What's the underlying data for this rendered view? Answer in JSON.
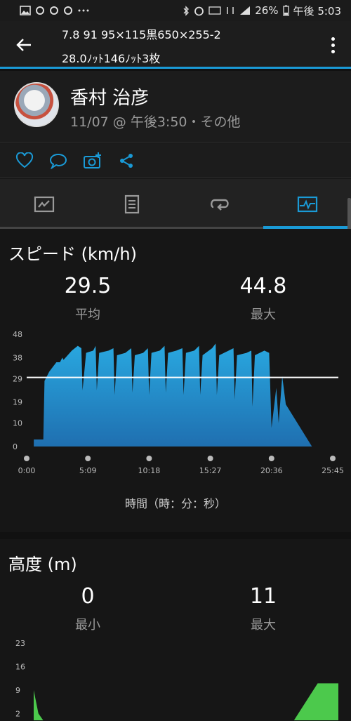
{
  "status_bar": {
    "battery": "26%",
    "time": "午後 5:03"
  },
  "header": {
    "title_line1": "7.8 91 95×115黒650×255-2",
    "title_line2": "28.0ﾉｯﾄ146ﾉｯﾄ3枚"
  },
  "profile": {
    "name": "香村 治彦",
    "meta": "11/07 @ 午後3:50・その他"
  },
  "speed": {
    "title": "スピード (km/h)",
    "avg_value": "29.5",
    "avg_label": "平均",
    "max_value": "44.8",
    "max_label": "最大",
    "x_title": "時間（時：分：秒）"
  },
  "altitude": {
    "title": "高度 (m)",
    "min_value": "0",
    "min_label": "最小",
    "max_value": "11",
    "max_label": "最大"
  },
  "colors": {
    "accent": "#1a9ad6",
    "speed_fill_top": "#29a8e0",
    "speed_fill_bottom": "#1f6fb0",
    "alt_fill": "#4cc94c"
  },
  "chart_data": [
    {
      "type": "area",
      "title": "スピード (km/h)",
      "xlabel": "時間（時：分：秒）",
      "ylabel": "",
      "y_ticks": [
        "0",
        "10",
        "19",
        "29",
        "38",
        "48"
      ],
      "x_ticks": [
        "0:00",
        "5:09",
        "10:18",
        "15:27",
        "20:36",
        "25:45"
      ],
      "ylim": [
        0,
        48
      ],
      "xlim": [
        0,
        25.75
      ],
      "reference_line": 29.5,
      "x": [
        0.6,
        1.4,
        1.5,
        1.9,
        2.2,
        2.5,
        2.8,
        3.0,
        3.1,
        3.8,
        4.3,
        4.6,
        4.7,
        5.0,
        5.6,
        5.8,
        5.9,
        6.1,
        6.9,
        7.3,
        7.4,
        7.6,
        8.3,
        8.8,
        8.9,
        9.1,
        9.8,
        10.2,
        10.3,
        10.5,
        11.2,
        11.6,
        11.7,
        11.9,
        12.6,
        13.1,
        13.2,
        13.4,
        14.1,
        14.5,
        14.6,
        14.8,
        15.6,
        15.9,
        16.0,
        16.2,
        17.0,
        17.4,
        17.5,
        17.7,
        18.5,
        18.9,
        19.0,
        19.2,
        20.0,
        20.4,
        20.6,
        21.0,
        21.2,
        21.5,
        21.8,
        24.0
      ],
      "y": [
        3,
        3,
        28,
        32,
        34,
        36,
        36,
        38,
        37,
        41,
        43,
        42,
        24,
        40,
        41,
        43,
        24,
        40,
        41,
        42,
        22,
        39,
        40,
        42,
        23,
        39,
        40,
        42,
        22,
        40,
        41,
        43,
        23,
        40,
        41,
        42,
        22,
        40,
        41,
        43,
        22,
        39,
        42,
        44,
        22,
        39,
        41,
        42,
        20,
        39,
        40,
        41,
        17,
        39,
        41,
        40,
        8,
        25,
        10,
        30,
        18,
        0
      ]
    },
    {
      "type": "area",
      "title": "高度 (m)",
      "xlabel": "",
      "ylabel": "",
      "y_ticks": [
        "2",
        "9",
        "16",
        "23"
      ],
      "ylim": [
        0,
        23
      ],
      "xlim": [
        0,
        25.75
      ],
      "x": [
        0.0,
        0.4,
        0.8,
        22.0,
        24.0,
        25.75
      ],
      "y": [
        9,
        2,
        0,
        0,
        11,
        11
      ]
    }
  ]
}
